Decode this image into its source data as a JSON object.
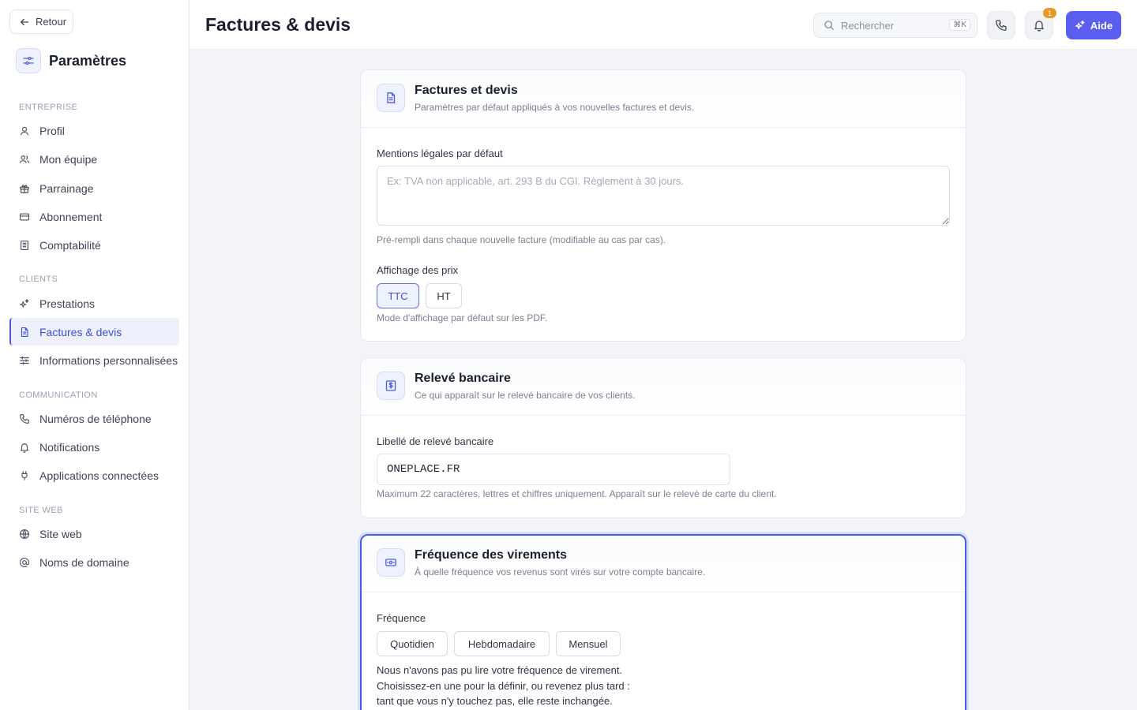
{
  "sidebar": {
    "back_label": "Retour",
    "title": "Paramètres",
    "sections": [
      {
        "label": "ENTREPRISE"
      },
      {
        "label": "CLIENTS"
      },
      {
        "label": "COMMUNICATION"
      },
      {
        "label": "SITE WEB"
      }
    ],
    "items": [
      {
        "label": "Profil",
        "icon": "user-icon"
      },
      {
        "label": "Mon équipe",
        "icon": "users-icon"
      },
      {
        "label": "Parrainage",
        "icon": "gift-icon"
      },
      {
        "label": "Abonnement",
        "icon": "credit-card-icon"
      },
      {
        "label": "Comptabilité",
        "icon": "ledger-icon"
      },
      {
        "label": "Prestations",
        "icon": "sparkles-icon"
      },
      {
        "label": "Factures & devis",
        "icon": "document-icon",
        "active": true
      },
      {
        "label": "Informations personnalisées",
        "icon": "sliders-icon"
      },
      {
        "label": "Numéros de téléphone",
        "icon": "phone-icon"
      },
      {
        "label": "Notifications",
        "icon": "bell-icon"
      },
      {
        "label": "Applications connectées",
        "icon": "plug-icon"
      },
      {
        "label": "Site web",
        "icon": "globe-icon"
      },
      {
        "label": "Noms de domaine",
        "icon": "at-icon"
      }
    ]
  },
  "header": {
    "title": "Factures & devis",
    "search_placeholder": "Rechercher",
    "search_shortcut": "⌘K",
    "notification_count": "1",
    "help_label": "Aide"
  },
  "invoices_card": {
    "title": "Factures et devis",
    "subtitle": "Paramètres par défaut appliqués à vos nouvelles factures et devis.",
    "legal_label": "Mentions légales par défaut",
    "legal_placeholder": "Ex: TVA non applicable, art. 293 B du CGI. Règlement à 30 jours.",
    "legal_hint": "Pré-rempli dans chaque nouvelle facture (modifiable au cas par cas).",
    "price_label": "Affichage des prix",
    "price_options": [
      "TTC",
      "HT"
    ],
    "price_selected": "TTC",
    "price_hint": "Mode d'affichage par défaut sur les PDF."
  },
  "bank_card": {
    "title": "Relevé bancaire",
    "subtitle": "Ce qui apparaît sur le relevé bancaire de vos clients.",
    "descriptor_label": "Libellé de relevé bancaire",
    "descriptor_value": "ONEPLACE.FR",
    "descriptor_hint": "Maximum 22 caractères, lettres et chiffres uniquement. Apparaît sur le relevé de carte du client."
  },
  "payout_card": {
    "title": "Fréquence des virements",
    "subtitle": "À quelle fréquence vos revenus sont virés sur votre compte bancaire.",
    "frequency_label": "Fréquence",
    "frequency_options": [
      "Quotidien",
      "Hebdomadaire",
      "Mensuel"
    ],
    "note_lines": [
      "Nous n'avons pas pu lire votre fréquence de virement.",
      "Choisissez-en une pour la définir, ou revenez plus tard :",
      "tant que vous n'y touchez pas, elle reste inchangée."
    ]
  },
  "colors": {
    "accent": "#4b5be0",
    "help_button": "#5b5ff0",
    "badge": "#e79a23"
  }
}
